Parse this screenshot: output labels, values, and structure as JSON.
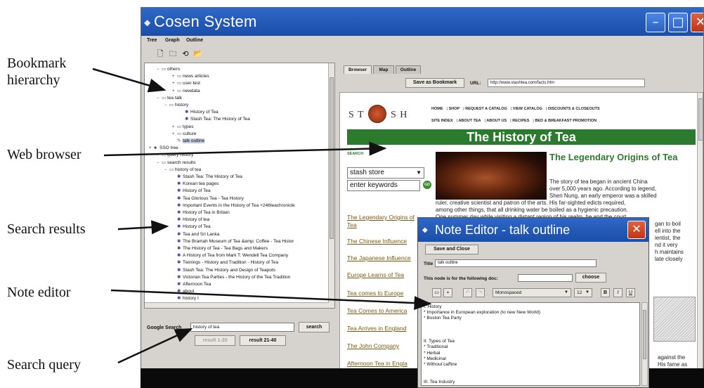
{
  "callouts": {
    "bookmark_line1": "Bookmark",
    "bookmark_line2": "hierarchy",
    "web_browser": "Web browser",
    "search_results": "Search results",
    "note_editor": "Note editor",
    "search_query": "Search query"
  },
  "window": {
    "title": "Cosen System",
    "menu": [
      "Tree",
      "Graph",
      "Outline"
    ]
  },
  "tree": {
    "rows": [
      {
        "label": "others",
        "icon": "folder"
      },
      {
        "label": "news articles",
        "icon": "folder"
      },
      {
        "label": "user test",
        "icon": "folder"
      },
      {
        "label": "newdata",
        "icon": "folder"
      },
      {
        "label": "tea talk",
        "icon": "folder"
      },
      {
        "label": "history",
        "icon": "folder"
      },
      {
        "label": "History of Tea",
        "icon": "page"
      },
      {
        "label": "Stash Tea: The History of Tea",
        "icon": "page"
      },
      {
        "label": "types",
        "icon": "folder"
      },
      {
        "label": "culture",
        "icon": "folder"
      },
      {
        "label": "talk outline",
        "icon": "note"
      },
      {
        "label": "SSO tree",
        "icon": "tree"
      },
      {
        "label": "query history",
        "icon": "folder"
      },
      {
        "label": "search results",
        "icon": "folder"
      },
      {
        "label": "history of tea",
        "icon": "folder"
      },
      {
        "label": "Stash Tea: The History of Tea",
        "icon": "page"
      },
      {
        "label": "Korean tea pages",
        "icon": "page"
      },
      {
        "label": "History of Tea",
        "icon": "page"
      },
      {
        "label": "Tea Glorious Tea - Tea History",
        "icon": "page"
      },
      {
        "label": "Important Events in the History of Tea +246teachronicle",
        "icon": "page"
      },
      {
        "label": "History of Tea in Britain",
        "icon": "page"
      },
      {
        "label": "History of tea",
        "icon": "page"
      },
      {
        "label": "History of Tea",
        "icon": "page"
      },
      {
        "label": "Tea and Sri Lanka",
        "icon": "page"
      },
      {
        "label": "The Bramah Museum of Tea &amp; Coffee - Tea Histor",
        "icon": "page"
      },
      {
        "label": "The History of Tea - Tea Bags and Makers",
        "icon": "page"
      },
      {
        "label": "A History of Tea from Mark T. Wendell Tea Company",
        "icon": "page"
      },
      {
        "label": "Twinings - History and Tradition - History of Tea",
        "icon": "page"
      },
      {
        "label": "Stash Tea: The History and Design of Teapots",
        "icon": "page"
      },
      {
        "label": "Victorian Tea Parties - the History of the Tea Tradition",
        "icon": "page"
      },
      {
        "label": "Afternoon Tea",
        "icon": "page"
      },
      {
        "label": "about",
        "icon": "page"
      },
      {
        "label": "history I",
        "icon": "page"
      }
    ]
  },
  "google_search": {
    "label": "Google Search",
    "value": "history of tea",
    "search_button": "search",
    "prev_button": "result 1-20",
    "next_button": "result 21-40"
  },
  "browser": {
    "tabs": [
      "Browser",
      "Map",
      "Outline"
    ],
    "save_bookmark": "Save as Bookmark",
    "url_label": "URL:",
    "url_value": "http://www.stashtea.com/facts.htm",
    "site": {
      "logo_left": "S T",
      "logo_right": "S H",
      "nav1": [
        "HOME",
        "SHOP",
        "REQUEST A CATALOG",
        "VIEW CATALOG",
        "DISCOUNTS & CLOSEOUTS"
      ],
      "nav2": [
        "SITE INDEX",
        "ABOUT TEA",
        "ABOUT US",
        "RECIPES",
        "BED & BREAKFAST PROMOTION"
      ],
      "banner": "The History of Tea",
      "search_heading": "SEARCH",
      "store_select": "stash store",
      "keywords_placeholder": "enter keywords",
      "go": "GO",
      "side_links": [
        "The Legendary Origins of",
        "Tea",
        "The Chinese Influence",
        "The Japanese Influence",
        "Europe Learns of Tea",
        "Tea comes to Europe",
        "Tea Comes to America",
        "Tea Arrives in England",
        "The John Company",
        "Afternoon Tea in Engla"
      ],
      "section_title": "The Legendary Origins of Tea",
      "para_short": [
        "The story of tea began in ancient China",
        "over 5,000 years ago. According to legend,",
        "Shen Nung, an early emperor was a skilled"
      ],
      "para_wide": [
        "ruler, creative scientist and patron of the arts. His far-sighted edicts required,",
        "among other things, that all drinking water be boiled as a hygienic precaution.",
        "One summer day while visiting a distant region of his realm, he and the court"
      ],
      "right_fragments": [
        "gan to boil",
        "ell into the",
        "ientist, the",
        "nd it very",
        "h maintains",
        "late closely"
      ],
      "bottom_fragments": [
        "against the",
        "His fame as"
      ]
    }
  },
  "note_editor": {
    "title": "Note Editor - talk outline",
    "save_close": "Save and Close",
    "title_label": "Title",
    "title_value": "talk outline",
    "doc_label": "This node is for the following doc:",
    "choose": "choose",
    "font": "Monospaced",
    "size": "12",
    "bold": "B",
    "italic": "I",
    "underline": "U",
    "lines": [
      "I. History",
      "* Importance in European exploration (to new New World)",
      "* Boston Tea Party",
      "",
      "",
      "",
      "II. Types of Tea",
      "* Traditional",
      "* Herbal",
      "* Medicinal",
      "* Without caffine",
      "",
      "",
      "III. Tea Industry"
    ]
  }
}
